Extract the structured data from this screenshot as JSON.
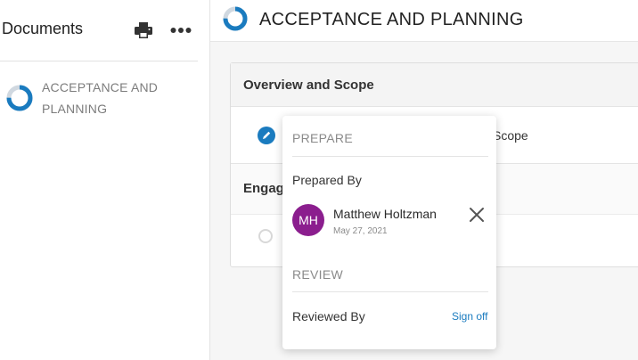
{
  "sidebar": {
    "title": "Documents",
    "print_icon": "print-icon",
    "more_icon": "more-horizontal-icon",
    "items": [
      {
        "label": "ACCEPTANCE AND PLANNING",
        "progress": 0.75
      }
    ]
  },
  "header": {
    "title": "ACCEPTANCE AND PLANNING",
    "progress": 0.75
  },
  "card": {
    "section1": {
      "title": "Overview and Scope",
      "row_text_visible": "Scope",
      "row_icon": "pencil-edit-icon"
    },
    "section2": {
      "title_visible": "Engag"
    }
  },
  "popover": {
    "prepare_title": "PREPARE",
    "prepared_by_label": "Prepared By",
    "preparer": {
      "initials": "MH",
      "name": "Matthew Holtzman",
      "date": "May 27, 2021",
      "avatar_color": "#8b1e8e"
    },
    "review_title": "REVIEW",
    "reviewed_by_label": "Reviewed By",
    "signoff_label": "Sign off"
  },
  "colors": {
    "accent": "#1a7bbf",
    "ring_track": "#d0d8e0"
  }
}
